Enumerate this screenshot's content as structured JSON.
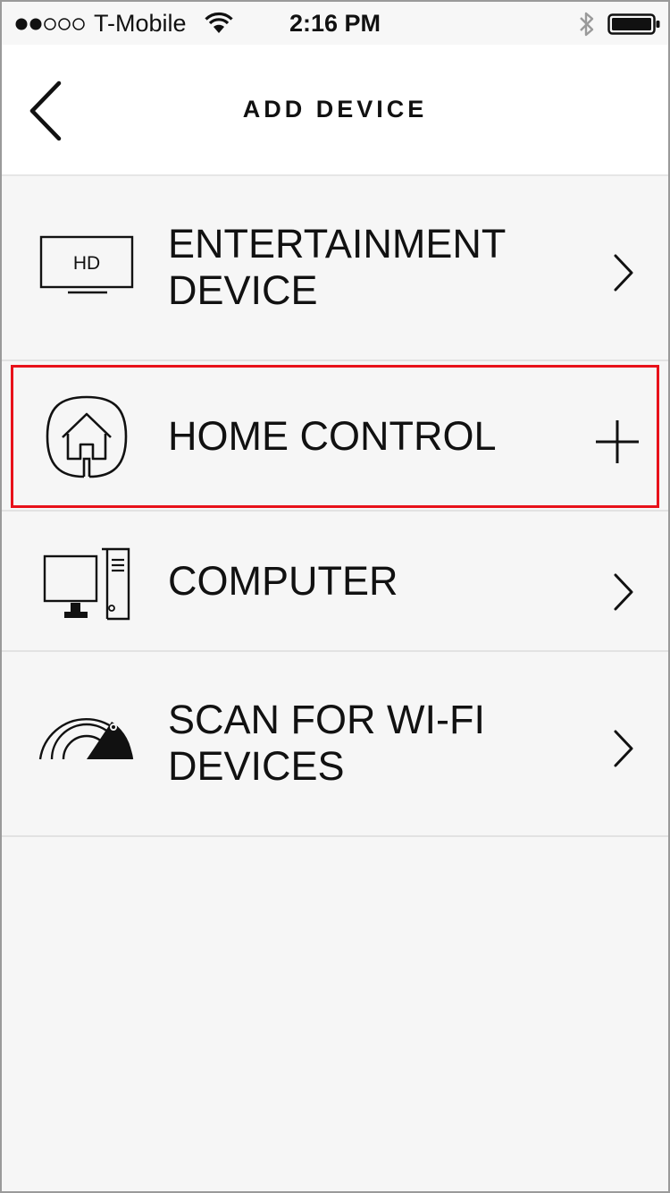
{
  "status_bar": {
    "carrier": "T-Mobile",
    "time": "2:16 PM",
    "signal_bars": 2,
    "signal_total": 5,
    "icons": [
      "signal-dots",
      "wifi-icon",
      "bluetooth-icon",
      "battery-icon"
    ]
  },
  "nav": {
    "title": "ADD DEVICE",
    "back_icon": "chevron-left-icon"
  },
  "devices": [
    {
      "label": "ENTERTAINMENT\nDEVICE",
      "icon": "hd-tv-icon",
      "action_icon": "chevron-right-icon"
    },
    {
      "label": "HOME CONTROL",
      "icon": "home-control-icon",
      "action_icon": "plus-icon"
    },
    {
      "label": "COMPUTER",
      "icon": "computer-icon",
      "action_icon": "chevron-right-icon"
    },
    {
      "label": "SCAN FOR WI-FI\nDEVICES",
      "icon": "wifi-scan-icon",
      "action_icon": "chevron-right-icon"
    }
  ],
  "tv_badge": "HD",
  "colors": {
    "highlight": "#e8111a",
    "background": "#f6f6f6",
    "nav_background": "#ffffff",
    "text": "#111111",
    "divider": "#e2e2e2"
  }
}
